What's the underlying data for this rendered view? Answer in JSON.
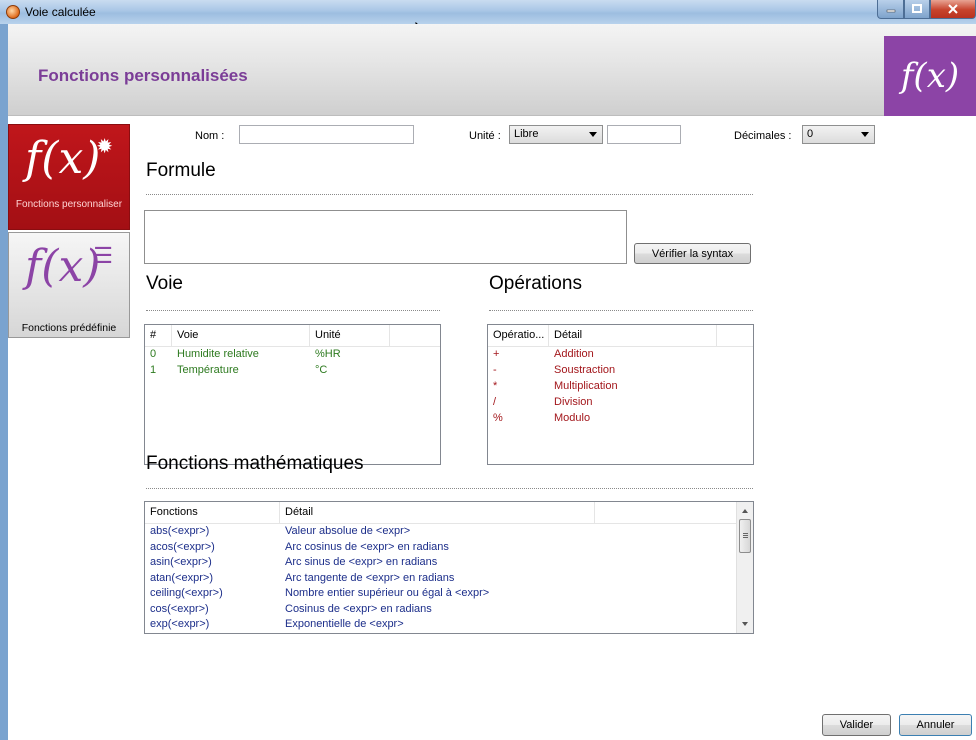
{
  "window": {
    "title": "Voie calculée"
  },
  "header": {
    "title": "Fonctions personnalisées",
    "logo": "f(x)"
  },
  "nav": [
    {
      "label": "Fonctions personnaliser",
      "icon": "fx-gear-icon",
      "active": true,
      "fx": "f(x)"
    },
    {
      "label": "Fonctions prédéfinie",
      "icon": "fx-list-icon",
      "active": false,
      "fx": "f(x)"
    }
  ],
  "form": {
    "name_label": "Nom :",
    "name_value": "",
    "unit_label": "Unité :",
    "unit_selected": "Libre",
    "unit_custom": "",
    "decimals_label": "Décimales :",
    "decimals_selected": "0"
  },
  "formula": {
    "title": "Formule",
    "value": "",
    "verify_label": "Vérifier la syntax"
  },
  "voie": {
    "title": "Voie",
    "columns": [
      "#",
      "Voie",
      "Unité"
    ],
    "rows": [
      {
        "num": "0",
        "voie": "Humidite relative",
        "unite": "%HR"
      },
      {
        "num": "1",
        "voie": "Température",
        "unite": "°C"
      }
    ]
  },
  "operations": {
    "title": "Opérations",
    "columns": [
      "Opératio...",
      "Détail"
    ],
    "rows": [
      {
        "op": "+",
        "detail": "Addition"
      },
      {
        "op": "-",
        "detail": "Soustraction"
      },
      {
        "op": "*",
        "detail": "Multiplication"
      },
      {
        "op": "/",
        "detail": "Division"
      },
      {
        "op": "%",
        "detail": "Modulo"
      }
    ]
  },
  "math": {
    "title": "Fonctions mathématiques",
    "columns": [
      "Fonctions",
      "Détail"
    ],
    "rows": [
      {
        "fn": "abs(<expr>)",
        "detail": "Valeur absolue de <expr>"
      },
      {
        "fn": "acos(<expr>)",
        "detail": "Arc cosinus de <expr> en radians"
      },
      {
        "fn": "asin(<expr>)",
        "detail": "Arc sinus de <expr> en radians"
      },
      {
        "fn": "atan(<expr>)",
        "detail": "Arc tangente de <expr> en radians"
      },
      {
        "fn": "ceiling(<expr>)",
        "detail": "Nombre entier supérieur ou égal à <expr>"
      },
      {
        "fn": "cos(<expr>)",
        "detail": "Cosinus de <expr> en radians"
      },
      {
        "fn": "exp(<expr>)",
        "detail": "Exponentielle de <expr>"
      }
    ]
  },
  "footer": {
    "ok_label": "Valider",
    "cancel_label": "Annuler"
  }
}
